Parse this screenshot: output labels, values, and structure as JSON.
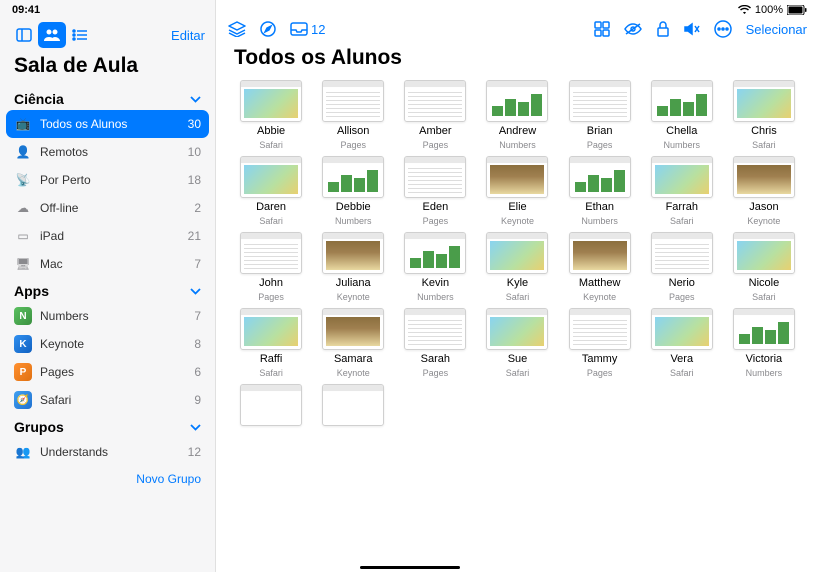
{
  "statusbar": {
    "time": "09:41",
    "battery": "100%"
  },
  "sidebar": {
    "edit_label": "Editar",
    "title": "Sala de Aula",
    "sections": [
      {
        "header": "Ciência",
        "items": [
          {
            "icon": "📺",
            "label": "Todos os Alunos",
            "count": 30,
            "selected": true
          },
          {
            "icon": "👤",
            "label": "Remotos",
            "count": 10
          },
          {
            "icon": "📡",
            "label": "Por Perto",
            "count": 18
          },
          {
            "icon": "☁︎",
            "label": "Off-line",
            "count": 2
          },
          {
            "icon": "▭",
            "label": "iPad",
            "count": 21
          },
          {
            "icon": "🖥",
            "label": "Mac",
            "count": 7
          }
        ]
      },
      {
        "header": "Apps",
        "items": [
          {
            "icon": "numbers",
            "label": "Numbers",
            "count": 7,
            "app": true
          },
          {
            "icon": "keynote",
            "label": "Keynote",
            "count": 8,
            "app": true
          },
          {
            "icon": "pages",
            "label": "Pages",
            "count": 6,
            "app": true
          },
          {
            "icon": "safari",
            "label": "Safari",
            "count": 9,
            "app": true
          }
        ]
      },
      {
        "header": "Grupos",
        "items": [
          {
            "icon": "👥",
            "label": "Understands",
            "count": 12
          }
        ]
      }
    ],
    "new_group": "Novo Grupo"
  },
  "toolbar": {
    "inbox_count": 12,
    "select_label": "Selecionar"
  },
  "content": {
    "title": "Todos os Alunos",
    "students": [
      {
        "name": "Abbie",
        "app": "Safari"
      },
      {
        "name": "Allison",
        "app": "Pages"
      },
      {
        "name": "Amber",
        "app": "Pages"
      },
      {
        "name": "Andrew",
        "app": "Numbers"
      },
      {
        "name": "Brian",
        "app": "Pages"
      },
      {
        "name": "Chella",
        "app": "Numbers"
      },
      {
        "name": "Chris",
        "app": "Safari"
      },
      {
        "name": "Daren",
        "app": "Safari"
      },
      {
        "name": "Debbie",
        "app": "Numbers"
      },
      {
        "name": "Eden",
        "app": "Pages"
      },
      {
        "name": "Elie",
        "app": "Keynote"
      },
      {
        "name": "Ethan",
        "app": "Numbers"
      },
      {
        "name": "Farrah",
        "app": "Safari"
      },
      {
        "name": "Jason",
        "app": "Keynote"
      },
      {
        "name": "John",
        "app": "Pages"
      },
      {
        "name": "Juliana",
        "app": "Keynote"
      },
      {
        "name": "Kevin",
        "app": "Numbers"
      },
      {
        "name": "Kyle",
        "app": "Safari"
      },
      {
        "name": "Matthew",
        "app": "Keynote"
      },
      {
        "name": "Nerio",
        "app": "Pages"
      },
      {
        "name": "Nicole",
        "app": "Safari"
      },
      {
        "name": "Raffi",
        "app": "Safari"
      },
      {
        "name": "Samara",
        "app": "Keynote"
      },
      {
        "name": "Sarah",
        "app": "Pages"
      },
      {
        "name": "Sue",
        "app": "Safari"
      },
      {
        "name": "Tammy",
        "app": "Pages"
      },
      {
        "name": "Vera",
        "app": "Safari"
      },
      {
        "name": "Victoria",
        "app": "Numbers"
      },
      {
        "name": "",
        "app": ""
      },
      {
        "name": "",
        "app": ""
      }
    ]
  }
}
